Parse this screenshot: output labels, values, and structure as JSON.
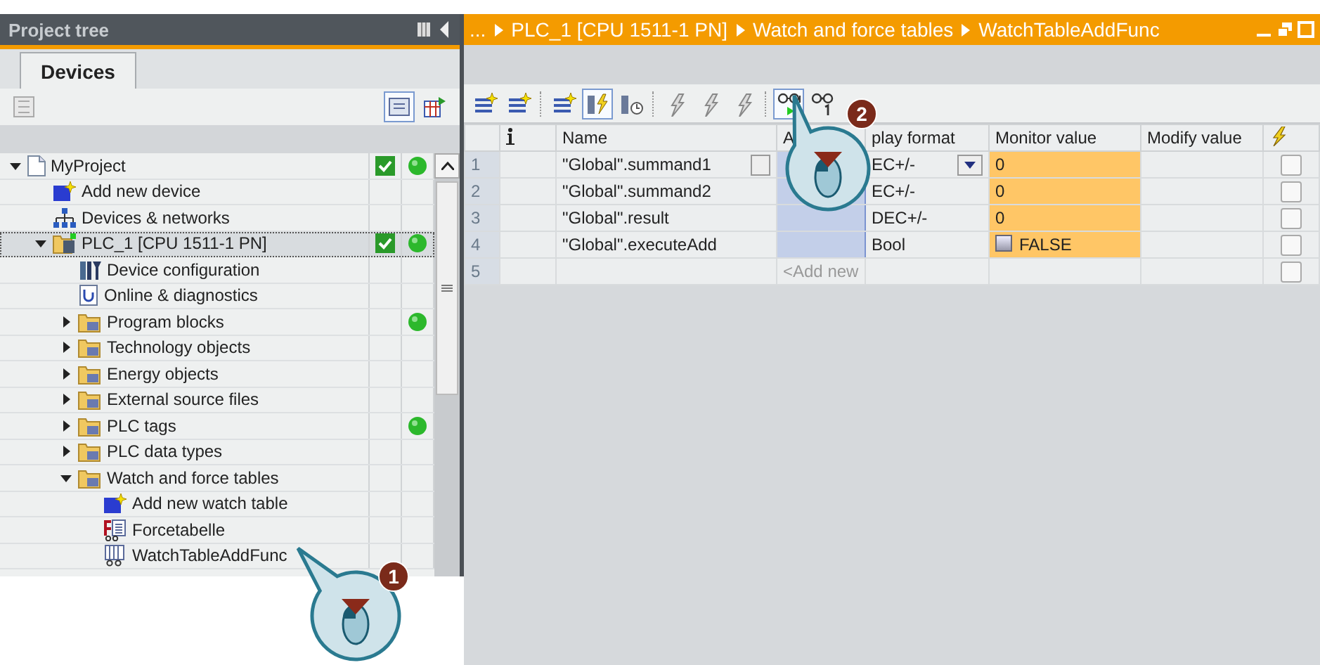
{
  "project_tree": {
    "title": "Project tree",
    "tabs": [
      {
        "label": "Devices",
        "selected": true
      }
    ],
    "items": [
      {
        "label": "MyProject",
        "kind": "project",
        "expanded": true,
        "selected": false,
        "consistent": true,
        "online": true,
        "children": [
          {
            "label": "Add new device",
            "kind": "add",
            "selected": false
          },
          {
            "label": "Devices & networks",
            "kind": "network",
            "selected": false
          },
          {
            "label": "PLC_1 [CPU 1511-1 PN]",
            "kind": "plc",
            "expanded": true,
            "selected": true,
            "consistent": true,
            "online": true,
            "children": [
              {
                "label": "Device configuration",
                "kind": "config",
                "selected": false
              },
              {
                "label": "Online & diagnostics",
                "kind": "diag",
                "selected": false
              },
              {
                "label": "Program blocks",
                "kind": "folder",
                "expanded": false,
                "selected": false,
                "online": true
              },
              {
                "label": "Technology objects",
                "kind": "folder",
                "expanded": false,
                "selected": false
              },
              {
                "label": "Energy objects",
                "kind": "folder",
                "expanded": false,
                "selected": false
              },
              {
                "label": "External source files",
                "kind": "folder",
                "expanded": false,
                "selected": false
              },
              {
                "label": "PLC tags",
                "kind": "folder",
                "expanded": false,
                "selected": false,
                "online": true
              },
              {
                "label": "PLC data types",
                "kind": "folder",
                "expanded": false,
                "selected": false
              },
              {
                "label": "Watch and force tables",
                "kind": "folder",
                "expanded": true,
                "selected": false,
                "children": [
                  {
                    "label": "Add new watch table",
                    "kind": "add",
                    "selected": false
                  },
                  {
                    "label": "Forcetabelle",
                    "kind": "forcetable",
                    "selected": false
                  },
                  {
                    "label": "WatchTableAddFunc",
                    "kind": "watchtable",
                    "selected": false
                  }
                ]
              }
            ]
          }
        ]
      }
    ]
  },
  "editor": {
    "breadcrumb": [
      "...",
      "PLC_1 [CPU 1511-1 PN]",
      "Watch and force tables",
      "WatchTableAddFunc"
    ],
    "toolbar": [
      {
        "kind": "insert-row",
        "selected": false
      },
      {
        "kind": "add-row",
        "selected": false
      },
      {
        "kind": "sep"
      },
      {
        "kind": "modify-value",
        "selected": false
      },
      {
        "kind": "show-force",
        "selected": true
      },
      {
        "kind": "show-trigger",
        "selected": false
      },
      {
        "kind": "sep"
      },
      {
        "kind": "modify-now",
        "selected": false
      },
      {
        "kind": "modify-trigger",
        "selected": false
      },
      {
        "kind": "enable-periphery",
        "selected": false
      },
      {
        "kind": "sep"
      },
      {
        "kind": "monitor-all",
        "selected": true
      },
      {
        "kind": "monitor-once",
        "selected": false
      }
    ],
    "columns": [
      {
        "kind": "index"
      },
      {
        "kind": "info"
      },
      {
        "kind": "text",
        "label": "Name"
      },
      {
        "kind": "text",
        "label": "A"
      },
      {
        "kind": "text",
        "label": "play format"
      },
      {
        "kind": "text",
        "label": "Monitor value"
      },
      {
        "kind": "text",
        "label": "Modify value"
      },
      {
        "kind": "force"
      }
    ],
    "rows": [
      {
        "index": "1",
        "name": "\"Global\".summand1",
        "format": "EC+/-",
        "monitor": "0",
        "kind": "value",
        "editing": true,
        "address_selected": true,
        "modify_checked": false
      },
      {
        "index": "2",
        "name": "\"Global\".summand2",
        "format": "EC+/-",
        "monitor": "0",
        "kind": "value",
        "editing": false,
        "address_selected": true,
        "modify_checked": false
      },
      {
        "index": "3",
        "name": "\"Global\".result",
        "format": "DEC+/-",
        "monitor": "0",
        "kind": "value",
        "editing": false,
        "address_selected": true,
        "modify_checked": false
      },
      {
        "index": "4",
        "name": "\"Global\".executeAdd",
        "format": "Bool",
        "monitor": "FALSE",
        "kind": "bool",
        "editing": false,
        "address_selected": true,
        "modify_checked": false
      },
      {
        "index": "5",
        "kind": "new",
        "address": "<Add new",
        "editing": false,
        "address_selected": false,
        "modify_checked": false
      }
    ]
  },
  "callouts": [
    {
      "number": "1"
    },
    {
      "number": "2"
    }
  ]
}
